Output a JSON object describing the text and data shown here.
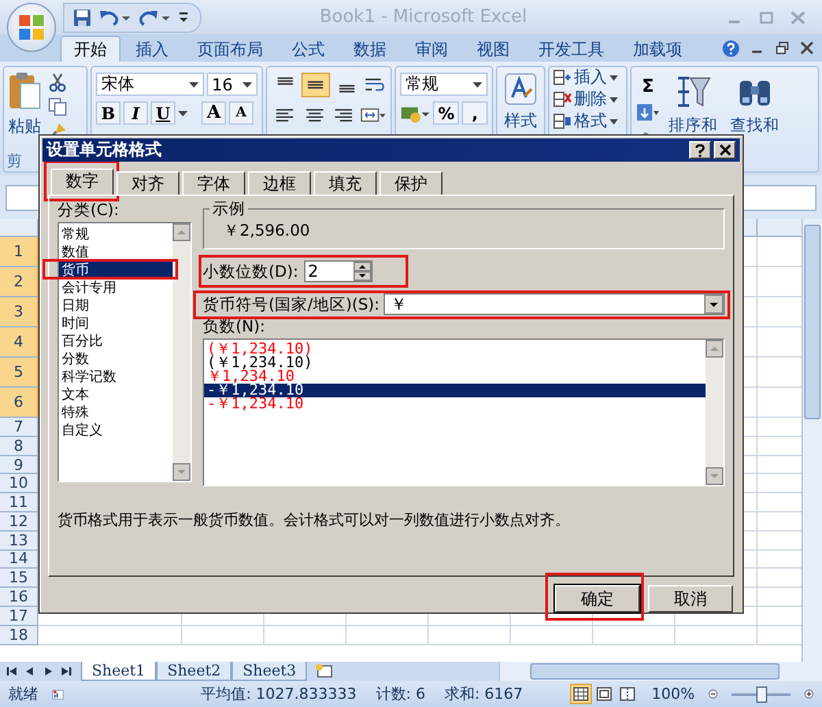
{
  "window": {
    "title": "Book1 - Microsoft Excel"
  },
  "ribbon_tabs": [
    {
      "label": "开始",
      "selected": true
    },
    {
      "label": "插入",
      "selected": false
    },
    {
      "label": "页面布局",
      "selected": false
    },
    {
      "label": "公式",
      "selected": false
    },
    {
      "label": "数据",
      "selected": false
    },
    {
      "label": "审阅",
      "selected": false
    },
    {
      "label": "视图",
      "selected": false
    },
    {
      "label": "开发工具",
      "selected": false
    },
    {
      "label": "加载项",
      "selected": false
    }
  ],
  "ribbon": {
    "paste_label": "粘贴",
    "group_label": "剪",
    "font_name": "宋体",
    "font_size": "16",
    "format_buttons": [
      "B",
      "I",
      "U"
    ],
    "size_buttons": [
      "A",
      "A"
    ],
    "number_format": "常规",
    "number_buttons": [
      "%",
      ","
    ],
    "styles_label": "样式",
    "cells": [
      "插入",
      "删除",
      "格式"
    ],
    "sum_symbol": "Σ",
    "editing": [
      "排序和",
      "查找和"
    ]
  },
  "row_headers": [
    {
      "label": "1",
      "selected": true
    },
    {
      "label": "2",
      "selected": true
    },
    {
      "label": "3",
      "selected": true
    },
    {
      "label": "4",
      "selected": true
    },
    {
      "label": "5",
      "selected": true
    },
    {
      "label": "6",
      "selected": true
    },
    {
      "label": "7",
      "selected": false
    },
    {
      "label": "8",
      "selected": false
    },
    {
      "label": "9",
      "selected": false
    },
    {
      "label": "10",
      "selected": false
    },
    {
      "label": "11",
      "selected": false
    },
    {
      "label": "12",
      "selected": false
    },
    {
      "label": "13",
      "selected": false
    },
    {
      "label": "14",
      "selected": false
    },
    {
      "label": "15",
      "selected": false
    },
    {
      "label": "16",
      "selected": false
    },
    {
      "label": "17",
      "selected": false
    },
    {
      "label": "18",
      "selected": false
    }
  ],
  "dialog": {
    "title": "设置单元格格式",
    "tabs": [
      {
        "label": "数字",
        "selected": true,
        "highlighted": true
      },
      {
        "label": "对齐",
        "selected": false,
        "highlighted": false
      },
      {
        "label": "字体",
        "selected": false,
        "highlighted": false
      },
      {
        "label": "边框",
        "selected": false,
        "highlighted": false
      },
      {
        "label": "填充",
        "selected": false,
        "highlighted": false
      },
      {
        "label": "保护",
        "selected": false,
        "highlighted": false
      }
    ],
    "category_label": "分类(C):",
    "categories": [
      {
        "label": "常规",
        "selected": false,
        "highlighted": false
      },
      {
        "label": "数值",
        "selected": false,
        "highlighted": false
      },
      {
        "label": "货币",
        "selected": true,
        "highlighted": true
      },
      {
        "label": "会计专用",
        "selected": false,
        "highlighted": false
      },
      {
        "label": "日期",
        "selected": false,
        "highlighted": false
      },
      {
        "label": "时间",
        "selected": false,
        "highlighted": false
      },
      {
        "label": "百分比",
        "selected": false,
        "highlighted": false
      },
      {
        "label": "分数",
        "selected": false,
        "highlighted": false
      },
      {
        "label": "科学记数",
        "selected": false,
        "highlighted": false
      },
      {
        "label": "文本",
        "selected": false,
        "highlighted": false
      },
      {
        "label": "特殊",
        "selected": false,
        "highlighted": false
      },
      {
        "label": "自定义",
        "selected": false,
        "highlighted": false
      }
    ],
    "sample_label": "示例",
    "sample_value": "￥2,596.00",
    "decimal_label": "小数位数(D):",
    "decimal_value": "2",
    "decimal_highlighted": true,
    "symbol_label": "货币符号(国家/地区)(S):",
    "symbol_value": "￥",
    "symbol_highlighted": true,
    "negative_label": "负数(N):",
    "negatives": [
      {
        "label": "(￥1,234.10)",
        "color": "#ff0000",
        "selected": false
      },
      {
        "label": "(￥1,234.10)",
        "color": "#000000",
        "selected": false
      },
      {
        "label": "￥1,234.10",
        "color": "#ff0000",
        "selected": false
      },
      {
        "label": "-￥1,234.10",
        "selected": true
      },
      {
        "label": "-￥1,234.10",
        "color": "#ff0000",
        "selected": false
      }
    ],
    "description": "货币格式用于表示一般货币数值。会计格式可以对一列数值进行小数点对齐。",
    "buttons": [
      {
        "label": "确定",
        "highlighted": true
      },
      {
        "label": "取消",
        "highlighted": false
      }
    ]
  },
  "sheet_tabs": [
    {
      "label": "Sheet1",
      "selected": true
    },
    {
      "label": "Sheet2",
      "selected": false
    },
    {
      "label": "Sheet3",
      "selected": false
    }
  ],
  "status_bar": {
    "ready": "就绪",
    "average": "平均值: 1027.833333",
    "count": "计数: 6",
    "sum": "求和: 6167",
    "view_buttons": [
      {
        "selected": true
      },
      {
        "selected": false
      },
      {
        "selected": false
      }
    ],
    "zoom": "100%",
    "zoom_slider": {
      "level": 0.5
    }
  }
}
